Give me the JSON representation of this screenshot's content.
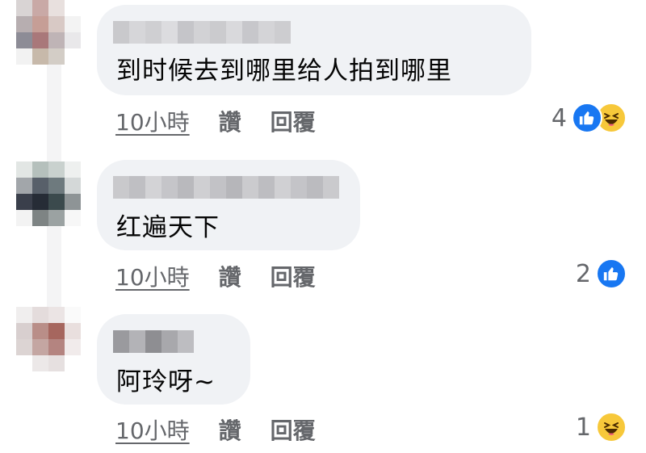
{
  "colors": {
    "bubble": "#f0f2f5",
    "meta_text": "#65676b",
    "like_blue": "#1877f2",
    "haha_yellow": "#f7c83a"
  },
  "comments": [
    {
      "text": "到时候去到哪里给人拍到哪里",
      "time": "10小時",
      "like_label": "讚",
      "reply_label": "回覆",
      "reaction_count": "4",
      "reactions": [
        "like-icon",
        "haha-icon"
      ]
    },
    {
      "text": "红遍天下",
      "time": "10小時",
      "like_label": "讚",
      "reply_label": "回覆",
      "reaction_count": "2",
      "reactions": [
        "like-icon"
      ]
    },
    {
      "text": "阿玲呀~",
      "time": "10小時",
      "like_label": "讚",
      "reply_label": "回覆",
      "reaction_count": "1",
      "reactions": [
        "haha-icon"
      ]
    }
  ]
}
